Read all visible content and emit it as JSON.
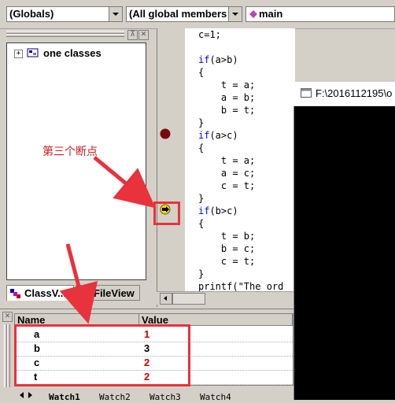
{
  "toolbar": {
    "scope_combo": "(Globals)",
    "members_combo": "(All global members",
    "function_combo": "main"
  },
  "classview": {
    "tree_root": "one classes",
    "tabs": [
      "ClassV...",
      "FileView"
    ]
  },
  "code": {
    "lines": [
      {
        "pre": "",
        "kw": "",
        "text": "c=1;"
      },
      {
        "pre": "",
        "kw": "",
        "text": ""
      },
      {
        "pre": "",
        "kw": "if",
        "text": "(a>b)"
      },
      {
        "pre": "",
        "kw": "",
        "text": "{"
      },
      {
        "pre": "    ",
        "kw": "",
        "text": "t = a;"
      },
      {
        "pre": "    ",
        "kw": "",
        "text": "a = b;"
      },
      {
        "pre": "    ",
        "kw": "",
        "text": "b = t;"
      },
      {
        "pre": "",
        "kw": "",
        "text": "}"
      },
      {
        "pre": "",
        "kw": "if",
        "text": "(a>c)"
      },
      {
        "pre": "",
        "kw": "",
        "text": "{"
      },
      {
        "pre": "    ",
        "kw": "",
        "text": "t = a;"
      },
      {
        "pre": "    ",
        "kw": "",
        "text": "a = c;"
      },
      {
        "pre": "    ",
        "kw": "",
        "text": "c = t;"
      },
      {
        "pre": "",
        "kw": "",
        "text": "}"
      },
      {
        "pre": "",
        "kw": "if",
        "text": "(b>c)"
      },
      {
        "pre": "",
        "kw": "",
        "text": "{"
      },
      {
        "pre": "    ",
        "kw": "",
        "text": "t = b;"
      },
      {
        "pre": "    ",
        "kw": "",
        "text": "b = c;"
      },
      {
        "pre": "    ",
        "kw": "",
        "text": "c = t;"
      },
      {
        "pre": "",
        "kw": "",
        "text": "}"
      },
      {
        "pre": "",
        "kw": "",
        "text": "printf(\"The ord"
      }
    ]
  },
  "console": {
    "title": "F:\\2016112195\\o"
  },
  "watch": {
    "headers": [
      "Name",
      "Value"
    ],
    "rows": [
      {
        "name": "a",
        "value": "1"
      },
      {
        "name": "b",
        "value": "3"
      },
      {
        "name": "c",
        "value": "2"
      },
      {
        "name": "t",
        "value": "2"
      }
    ],
    "tabs": [
      "Watch1",
      "Watch2",
      "Watch3",
      "Watch4"
    ]
  },
  "annotation": {
    "label": "第三个断点"
  },
  "colors": {
    "breakpoint": "#7a0a0a",
    "annotation_red": "#e8323c",
    "value_red": "#cc0000",
    "keyword_blue": "#0000ff"
  }
}
